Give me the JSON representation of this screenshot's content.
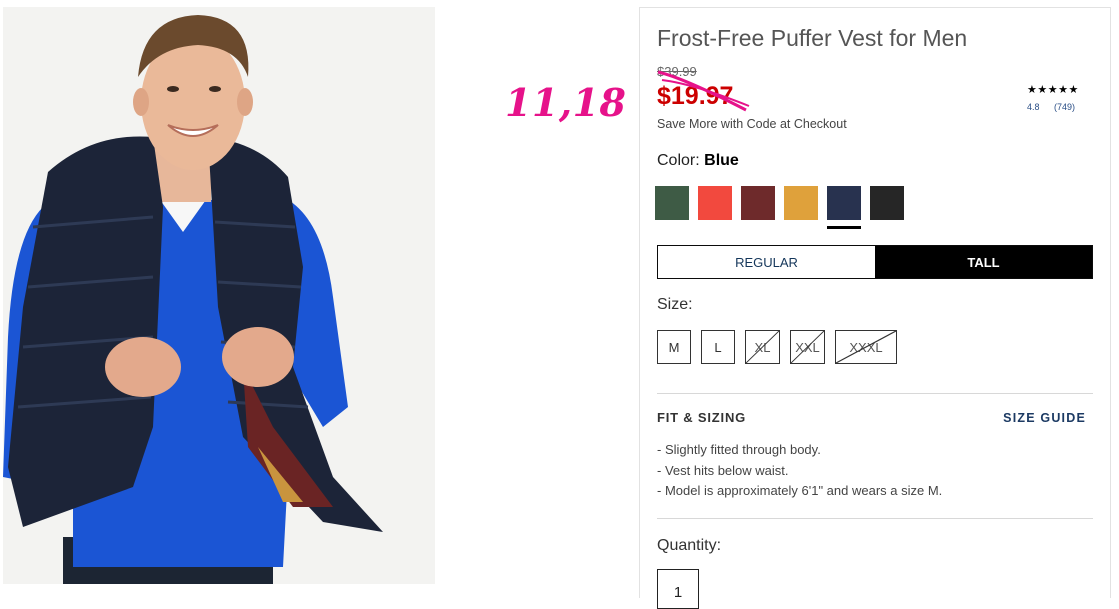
{
  "annotation": "11,18",
  "product": {
    "title": "Frost-Free Puffer Vest for Men",
    "original_price": "$39.99",
    "sale_price": "$19.97",
    "promo": "Save More with Code at Checkout",
    "rating": {
      "stars": "★★★★★",
      "score": "4.8",
      "count": "(749)"
    }
  },
  "color": {
    "label": "Color:",
    "selected": "Blue",
    "swatches": [
      {
        "name": "green",
        "hex": "#3e5b45"
      },
      {
        "name": "coral",
        "hex": "#f2493e"
      },
      {
        "name": "maroon",
        "hex": "#6e2a2b"
      },
      {
        "name": "mustard",
        "hex": "#dfa13b"
      },
      {
        "name": "navy",
        "hex": "#28324f",
        "selected": true
      },
      {
        "name": "black",
        "hex": "#262626"
      }
    ]
  },
  "fit": {
    "options": [
      "REGULAR",
      "TALL"
    ],
    "selected": "TALL"
  },
  "size": {
    "label": "Size:",
    "options": [
      {
        "label": "M",
        "available": true
      },
      {
        "label": "L",
        "available": true
      },
      {
        "label": "XL",
        "available": false
      },
      {
        "label": "XXL",
        "available": false
      },
      {
        "label": "XXXL",
        "available": false
      }
    ]
  },
  "fit_sizing": {
    "heading": "FIT & SIZING",
    "guide_link": "SIZE GUIDE",
    "details": [
      "Slightly fitted through body.",
      "Vest hits below waist.",
      "Model is approximately 6'1\" and wears a size M."
    ]
  },
  "quantity": {
    "label": "Quantity:",
    "value": "1"
  },
  "colors": {
    "sale_red": "#cc0000",
    "annotation_pink": "#e6128a",
    "link_navy": "#1c3a63"
  }
}
